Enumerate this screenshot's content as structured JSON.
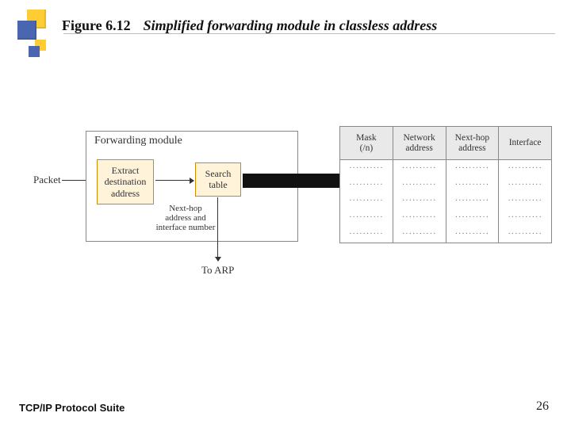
{
  "header": {
    "figure_no": "Figure 6.12",
    "figure_title": "Simplified forwarding module in classless address"
  },
  "diagram": {
    "packet_label": "Packet",
    "module_label": "Forwarding module",
    "extract_box": "Extract\ndestination\naddress",
    "search_box": "Search\ntable",
    "below_label": "Next-hop address and\ninterface number",
    "to_arp": "To ARP",
    "table": {
      "columns": [
        "Mask\n(/n)",
        "Network\naddress",
        "Next-hop\naddress",
        "Interface"
      ],
      "placeholder": "··········"
    }
  },
  "footer": {
    "left": "TCP/IP Protocol Suite",
    "page": "26"
  }
}
